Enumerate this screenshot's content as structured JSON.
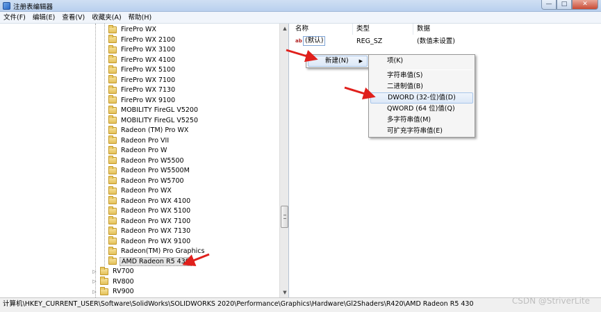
{
  "window": {
    "title": "注册表编辑器",
    "min": "—",
    "max": "□",
    "close": "✕"
  },
  "menubar": [
    "文件(F)",
    "编辑(E)",
    "查看(V)",
    "收藏夹(A)",
    "帮助(H)"
  ],
  "tree": {
    "child_items": [
      "FirePro WX",
      "FirePro WX 2100",
      "FirePro WX 3100",
      "FirePro WX 4100",
      "FirePro WX 5100",
      "FirePro WX 7100",
      "FirePro WX 7130",
      "FirePro WX 9100",
      "MOBILITY FireGL V5200",
      "MOBILITY FireGL V5250",
      "Radeon (TM) Pro WX",
      "Radeon Pro VII",
      "Radeon Pro W",
      "Radeon Pro W5500",
      "Radeon Pro W5500M",
      "Radeon Pro W5700",
      "Radeon Pro WX",
      "Radeon Pro WX 4100",
      "Radeon Pro WX 5100",
      "Radeon Pro WX 7100",
      "Radeon Pro WX 7130",
      "Radeon Pro WX 9100",
      "Radeon(TM) Pro Graphics",
      "AMD Radeon R5 430"
    ],
    "selected": "AMD Radeon R5 430",
    "parent_items": [
      "RV700",
      "RV800",
      "RV900"
    ]
  },
  "list": {
    "headers": {
      "name": "名称",
      "type": "类型",
      "data": "数据"
    },
    "rows": [
      {
        "name": "(默认)",
        "type": "REG_SZ",
        "data": "(数值未设置)"
      }
    ]
  },
  "context_menu": {
    "new": "新建(N)"
  },
  "submenu": {
    "key": "项(K)",
    "items": [
      "字符串值(S)",
      "二进制值(B)",
      "DWORD (32-位)值(D)",
      "QWORD (64 位)值(Q)",
      "多字符串值(M)",
      "可扩充字符串值(E)"
    ],
    "highlighted": "DWORD (32-位)值(D)"
  },
  "statusbar": {
    "path": "计算机\\HKEY_CURRENT_USER\\Software\\SolidWorks\\SOLIDWORKS 2020\\Performance\\Graphics\\Hardware\\Gl2Shaders\\R420\\AMD Radeon R5 430"
  },
  "watermark": "CSDN @StriverLite",
  "colors": {
    "annotation_arrow": "#e0201c",
    "selection": "#cde4f7",
    "menu_bg": "#f5f5f5"
  }
}
